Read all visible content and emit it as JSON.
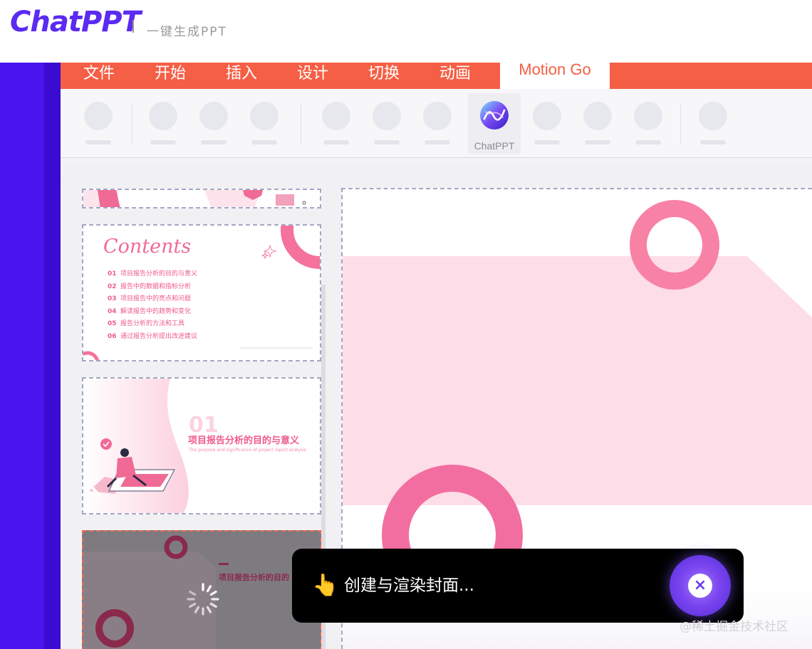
{
  "brand": {
    "logo": "ChatPPT",
    "tagline": "一键生成PPT"
  },
  "ribbon": {
    "tabs": [
      "文件",
      "开始",
      "插入",
      "设计",
      "切换",
      "动画"
    ],
    "active_tab": "Motion Go",
    "accent_color": "#f55f45"
  },
  "toolbar": {
    "chatppt_label": "ChatPPT",
    "placeholder_tools_count_hint": "skeleton"
  },
  "slides": {
    "contents": {
      "title": "Contents",
      "items": [
        {
          "num": "01",
          "text": "项目报告分析的目的与意义"
        },
        {
          "num": "02",
          "text": "报告中的数据和指标分析"
        },
        {
          "num": "03",
          "text": "项目报告中的亮点和问题"
        },
        {
          "num": "04",
          "text": "解读报告中的趋势和变化"
        },
        {
          "num": "05",
          "text": "报告分析的方法和工具"
        },
        {
          "num": "06",
          "text": "通过报告分析提出改进建议"
        }
      ]
    },
    "section": {
      "num": "01",
      "title": "项目报告分析的目的与意义",
      "subtitle": "The purpose and significance of project report analysis"
    },
    "loading_slide": {
      "title": "项目报告分析的目的"
    }
  },
  "toast": {
    "emoji": "👆",
    "message": "创建与渲染封面..."
  },
  "watermark": "@稀土掘金技术社区",
  "colors": {
    "purple": "#4a14ee",
    "pink": "#f06a96",
    "light_pink": "#fddde8"
  }
}
